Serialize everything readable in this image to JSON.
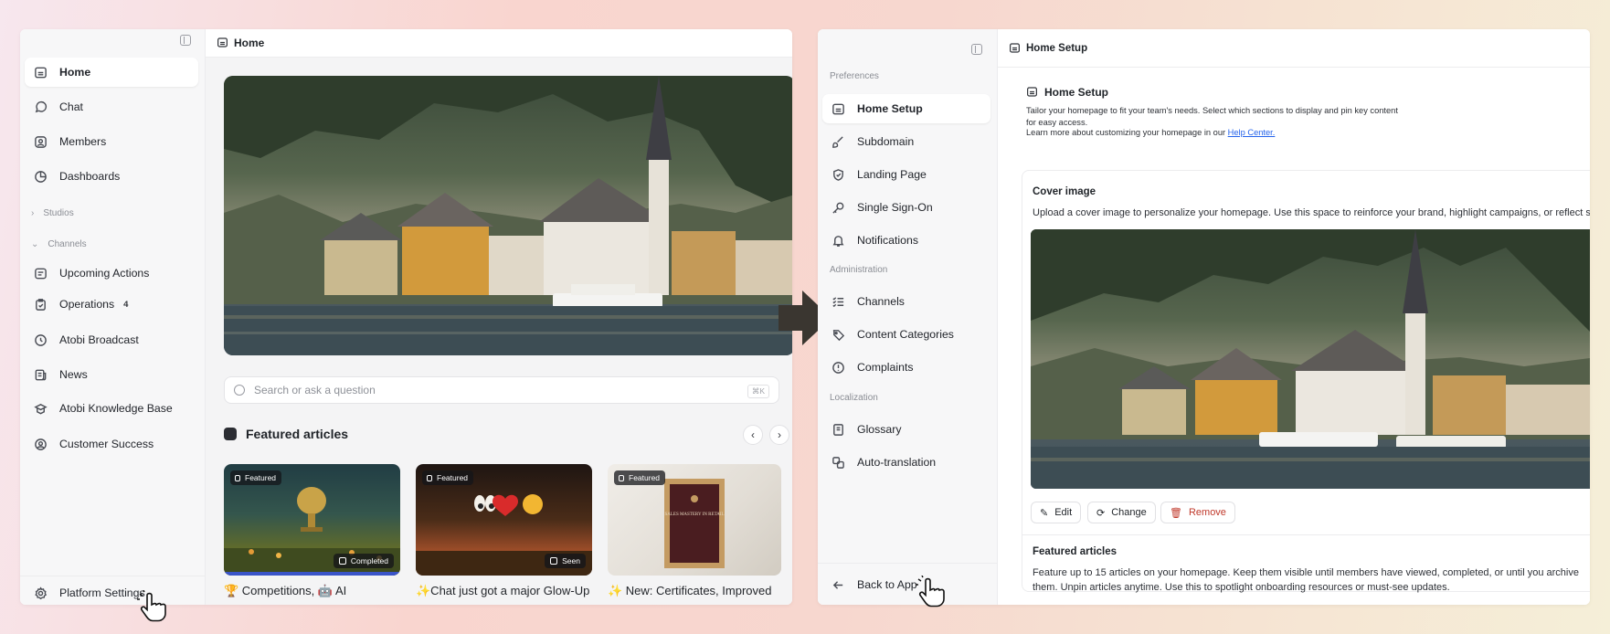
{
  "left_app": {
    "sidebar": {
      "items": [
        {
          "label": "Home",
          "icon": "home-icon",
          "active": true
        },
        {
          "label": "Chat",
          "icon": "chat-icon"
        },
        {
          "label": "Members",
          "icon": "members-icon"
        },
        {
          "label": "Dashboards",
          "icon": "dashboard-icon"
        }
      ],
      "studios_label": "Studios",
      "channels_label": "Channels",
      "channels": [
        {
          "label": "Upcoming Actions",
          "icon": "checklist-icon"
        },
        {
          "label": "Operations",
          "icon": "clipboard-icon",
          "badge": "4"
        },
        {
          "label": "Atobi Broadcast",
          "icon": "broadcast-icon"
        },
        {
          "label": "News",
          "icon": "news-icon"
        },
        {
          "label": "Atobi Knowledge Base",
          "icon": "knowledge-icon"
        },
        {
          "label": "Customer Success",
          "icon": "customer-icon"
        }
      ],
      "footer_label": "Platform Settings"
    },
    "header_title": "Home",
    "search_placeholder": "Search or ask a question",
    "search_shortcut": "⌘K",
    "featured_title": "Featured articles",
    "cards": [
      {
        "tag": "Featured",
        "status": "Completed",
        "title": "🏆 Competitions, 🤖 AI"
      },
      {
        "tag": "Featured",
        "status": "Seen",
        "title": "✨Chat just got a major Glow-Up"
      },
      {
        "tag": "Featured",
        "status": "",
        "title": "✨ New: Certificates, Improved"
      }
    ],
    "poster_text": "SALES MASTERY IN RETAIL"
  },
  "right_app": {
    "sidebar": {
      "preferences_label": "Preferences",
      "preferences": [
        {
          "label": "Home Setup",
          "icon": "home-icon",
          "active": true
        },
        {
          "label": "Subdomain",
          "icon": "brush-icon"
        },
        {
          "label": "Landing Page",
          "icon": "shield-check-icon"
        },
        {
          "label": "Single Sign-On",
          "icon": "key-icon"
        },
        {
          "label": "Notifications",
          "icon": "bell-icon"
        }
      ],
      "administration_label": "Administration",
      "administration": [
        {
          "label": "Channels",
          "icon": "checklist-icon"
        },
        {
          "label": "Content Categories",
          "icon": "tag-icon"
        },
        {
          "label": "Complaints",
          "icon": "alert-icon"
        }
      ],
      "localization_label": "Localization",
      "localization": [
        {
          "label": "Glossary",
          "icon": "book-icon"
        },
        {
          "label": "Auto-translation",
          "icon": "translate-icon"
        }
      ],
      "back_label": "Back to App"
    },
    "header_title": "Home Setup",
    "page_title": "Home Setup",
    "desc_line1": "Tailor your homepage to fit your team's needs. Select which sections to display and pin key content for easy access.",
    "desc_line2_prefix": "Learn more about customizing your homepage in our ",
    "help_link": "Help Center.",
    "cover": {
      "label": "Cover image",
      "description": "Upload a cover image to personalize your homepage. Use this space to reinforce your brand, highlight campaigns, or reflect seasonal themes.",
      "buttons": {
        "edit": "Edit",
        "change": "Change",
        "remove": "Remove"
      }
    },
    "featured": {
      "label": "Featured articles",
      "description": "Feature up to 15 articles on your homepage. Keep them visible until members have viewed, completed, or until you archive them. Unpin articles anytime. Use this to spotlight onboarding resources or must-see updates."
    }
  },
  "colors": {
    "remove_red": "#c0392b",
    "link_blue": "#2563eb",
    "accent_dark": "#2b2d33"
  }
}
